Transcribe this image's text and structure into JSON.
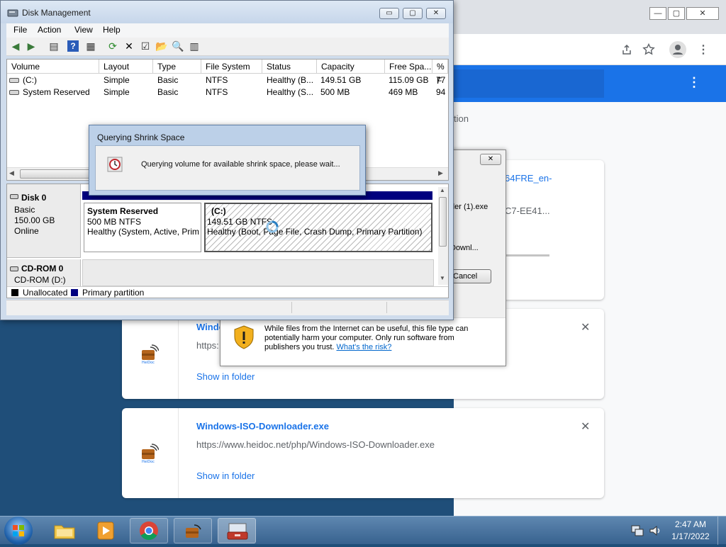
{
  "disk_management": {
    "title": "Disk Management",
    "window_buttons": {
      "minimize": "▭",
      "maximize": "▢",
      "close": "✕"
    },
    "menu": [
      "File",
      "Action",
      "View",
      "Help"
    ],
    "columns": [
      "Volume",
      "Layout",
      "Type",
      "File System",
      "Status",
      "Capacity",
      "Free Spa...",
      "% F"
    ],
    "volumes": [
      {
        "volume": "(C:)",
        "layout": "Simple",
        "type": "Basic",
        "fs": "NTFS",
        "status": "Healthy (B...",
        "capacity": "149.51 GB",
        "free": "115.09 GB",
        "pct": "77"
      },
      {
        "volume": "System Reserved",
        "layout": "Simple",
        "type": "Basic",
        "fs": "NTFS",
        "status": "Healthy (S...",
        "capacity": "500 MB",
        "free": "469 MB",
        "pct": "94"
      }
    ],
    "disk0": {
      "name": "Disk 0",
      "type": "Basic",
      "size": "150.00 GB",
      "state": "Online",
      "partitions": [
        {
          "name": "System Reserved",
          "size": "500 MB NTFS",
          "status": "Healthy (System, Active, Prim"
        },
        {
          "name": "(C:)",
          "size": "149.51 GB NTFS",
          "status": "Healthy (Boot, Page File, Crash Dump, Primary Partition)"
        }
      ]
    },
    "cdrom": {
      "name": "CD-ROM 0",
      "drive": "CD-ROM (D:)"
    },
    "legend": {
      "unallocated": "Unallocated",
      "primary": "Primary partition"
    },
    "colors": {
      "unallocated": "#000000",
      "primary": "#00007f"
    }
  },
  "query_dialog": {
    "title": "Querying Shrink Space",
    "message": "Querying volume for available shrink space, please wait..."
  },
  "security_dialog": {
    "close": "✕",
    "file_partial": "der (1).exe",
    "from_partial": "Downl...",
    "cancel": "Cancel",
    "warning_text": "While files from the Internet can be useful, this file type can potentially harm your computer. Only run software from publishers you trust.",
    "risk_link": "What's the risk?"
  },
  "chrome": {
    "window_buttons": {
      "minimize": "—",
      "maximize": "▢",
      "close": "✕"
    },
    "page_fragment": "tion",
    "downloads": [
      {
        "name_partial": "64FRE_en-",
        "hash_partial": "C7-EE41..."
      },
      {
        "name": "Windo",
        "url": "https:",
        "action": "Show in folder",
        "close": "✕"
      },
      {
        "name": "Windows-ISO-Downloader.exe",
        "url": "https://www.heidoc.net/php/Windows-ISO-Downloader.exe",
        "action": "Show in folder",
        "close": "✕"
      }
    ],
    "app_label": "HeiDoc"
  },
  "taskbar": {
    "time": "2:47 AM",
    "date": "1/17/2022"
  }
}
